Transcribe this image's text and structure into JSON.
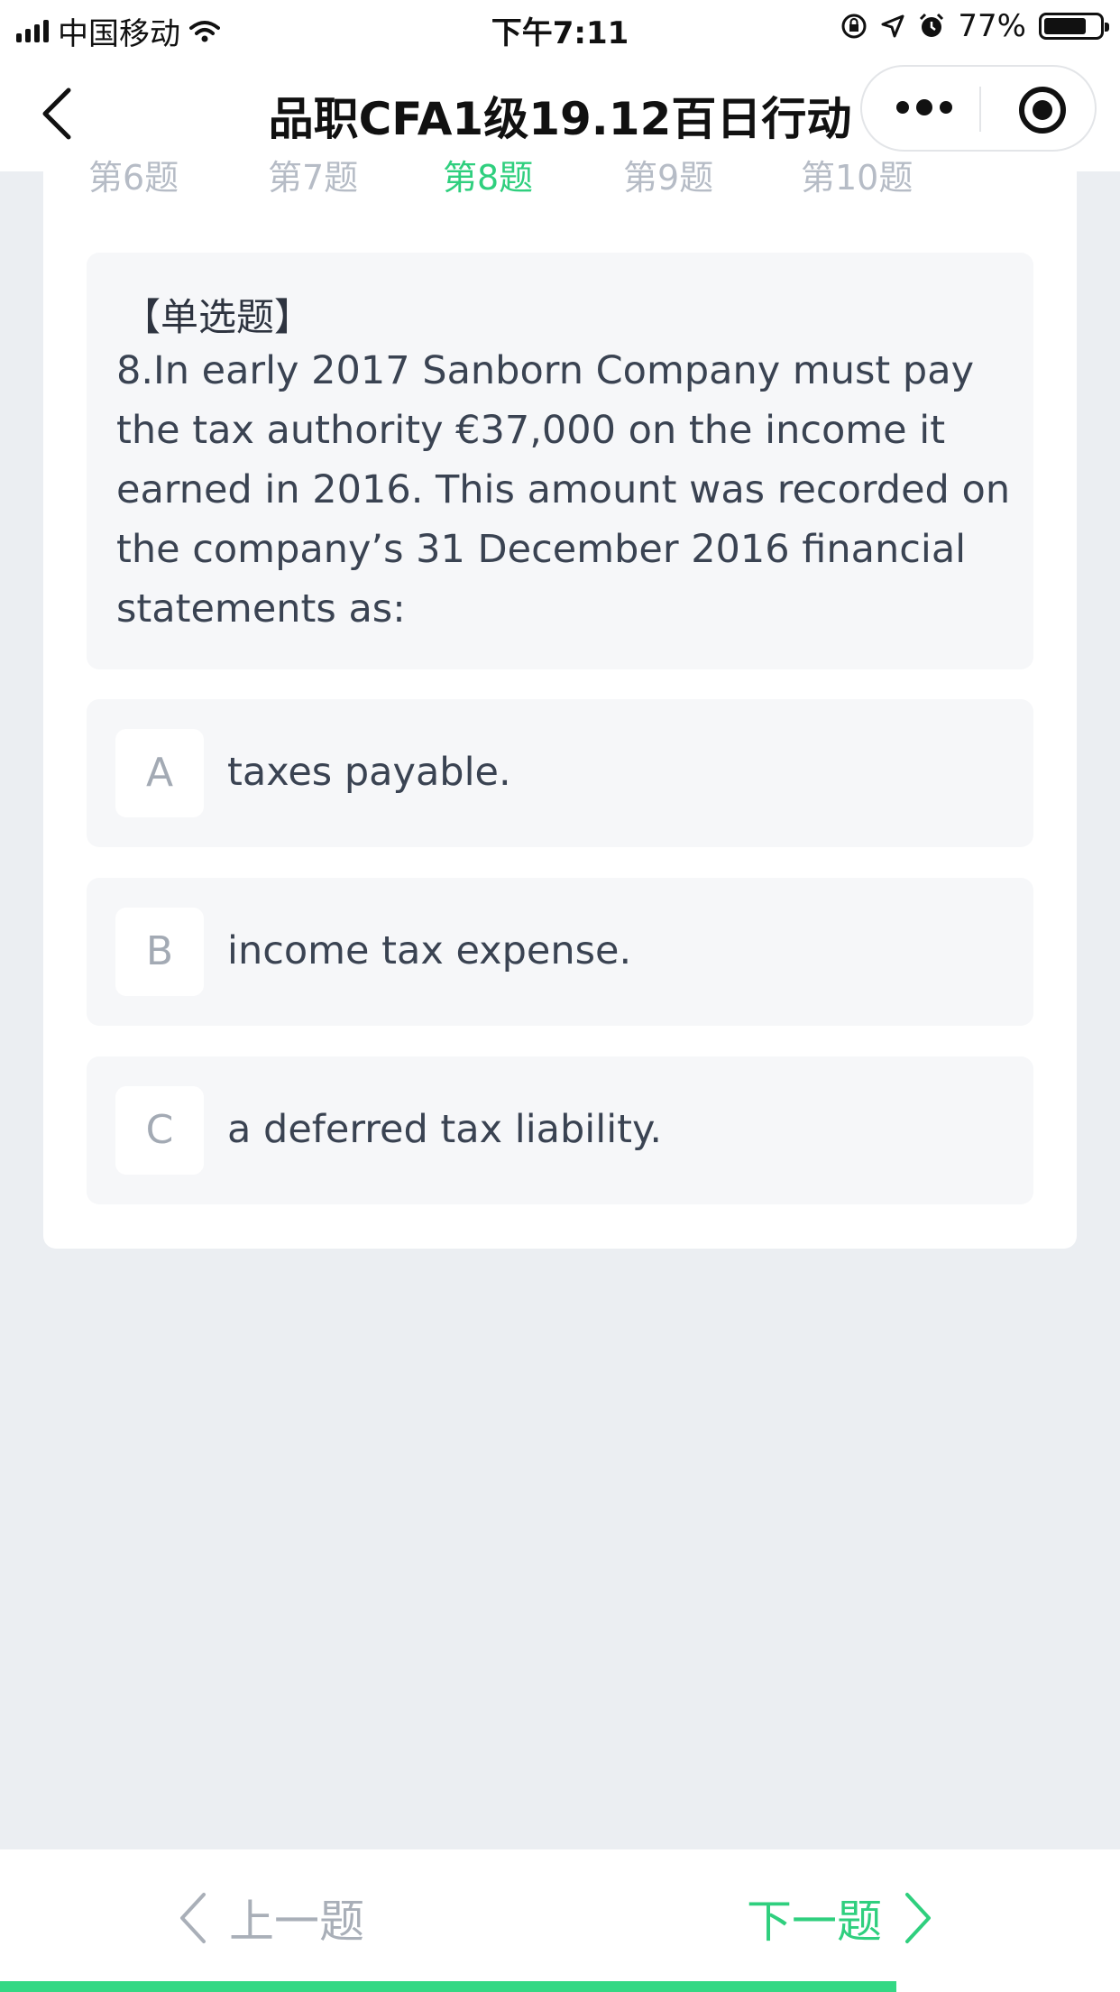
{
  "status_bar": {
    "carrier": "中国移动",
    "time": "下午7:11",
    "battery_text": "77%",
    "battery_level": 0.77,
    "icons": [
      "signal-icon",
      "wifi-icon",
      "rotation-lock-icon",
      "location-icon",
      "alarm-icon",
      "battery-icon"
    ]
  },
  "nav": {
    "title": "品职CFA1级19.12百日行动",
    "back_icon": "chevron-left-icon",
    "more_icon": "more-dots-icon",
    "close_icon": "target-icon"
  },
  "tabs": [
    {
      "label": "第6题",
      "active": false
    },
    {
      "label": "第7题",
      "active": false
    },
    {
      "label": "第8题",
      "active": true
    },
    {
      "label": "第9题",
      "active": false
    },
    {
      "label": "第10题",
      "active": false
    }
  ],
  "question": {
    "type_label": "【单选题】",
    "text": "8.In early 2017 Sanborn Company must pay the tax authority €37,000 on the income it earned in 2016. This amount was recorded on the company’s 31 December 2016 financial statements as:"
  },
  "options": [
    {
      "letter": "A",
      "text": "taxes payable."
    },
    {
      "letter": "B",
      "text": "income tax expense."
    },
    {
      "letter": "C",
      "text": "a deferred tax liability."
    }
  ],
  "footer": {
    "prev_label": "上一题",
    "next_label": "下一题",
    "progress": 0.8
  },
  "colors": {
    "accent": "#2fcf7e",
    "background": "#ebeef2",
    "muted": "#b6bcc6"
  }
}
